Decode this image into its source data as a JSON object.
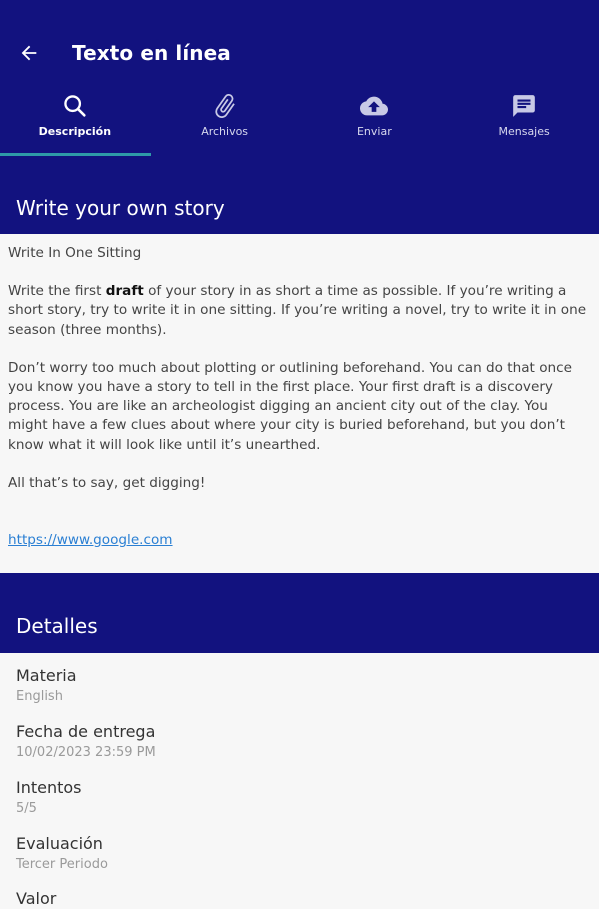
{
  "header": {
    "title": "Texto en línea",
    "back_icon": "arrow-left-icon"
  },
  "tabs": [
    {
      "label": "Descripción",
      "icon": "search-icon",
      "active": true
    },
    {
      "label": "Archivos",
      "icon": "paperclip-icon",
      "active": false
    },
    {
      "label": "Enviar",
      "icon": "cloud-upload-icon",
      "active": false
    },
    {
      "label": "Mensajes",
      "icon": "message-icon",
      "active": false
    }
  ],
  "story": {
    "title": "Write your own story",
    "subtitle": "Write In One Sitting",
    "p1_before": "Write the first ",
    "p1_bold": "draft",
    "p1_after": " of your story in as short a time as possible. If you’re writing a short story, try to write it in one sitting. If you’re writing a novel, try to write it in one season (three months).",
    "p2": "Don’t worry too much about plotting or outlining beforehand. You can do that once you know you have a story to tell in the first place. Your first draft is a discovery process. You are like an archeologist digging an ancient city out of the clay. You might have a few clues about where your city is buried beforehand, but you don’t know what it will look like until it’s unearthed.",
    "p3": "All that’s to say, get digging!",
    "link": "https://www.google.com"
  },
  "details": {
    "title": "Detalles",
    "items": [
      {
        "label": "Materia",
        "value": "English"
      },
      {
        "label": "Fecha de entrega",
        "value": "10/02/2023 23:59 PM"
      },
      {
        "label": "Intentos",
        "value": "5/5"
      },
      {
        "label": "Evaluación",
        "value": "Tercer Periodo"
      },
      {
        "label": "Valor",
        "value": ""
      }
    ]
  },
  "colors": {
    "primary": "#12127f",
    "tab_indicator": "#2e9aa8",
    "link": "#2a7fd3"
  }
}
